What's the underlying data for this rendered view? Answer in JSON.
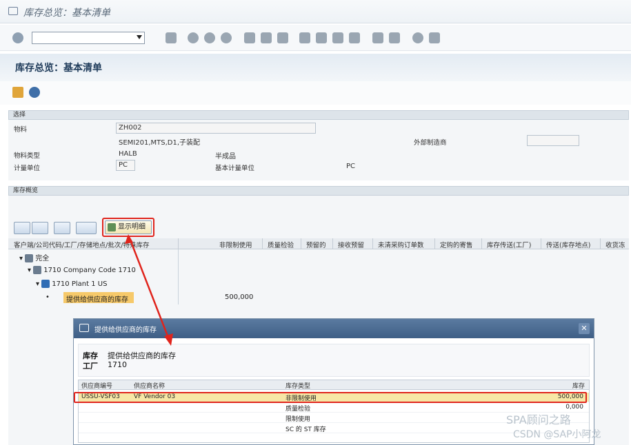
{
  "window": {
    "title": "库存总览：基本清单"
  },
  "banner": {
    "title": "库存总览：基本清单"
  },
  "selection": {
    "section_label": "选择",
    "material_label": "物料",
    "material_value": "ZH002",
    "material_desc": "SEMI201,MTS,D1,子装配",
    "ext_vendor_label": "外部制造商",
    "ext_vendor_value": "",
    "type_label": "物料类型",
    "type_code": "HALB",
    "type_name": "半成品",
    "uom_label": "计量单位",
    "uom_value": "PC",
    "base_uom_label": "基本计量单位",
    "base_uom_value": "PC"
  },
  "overview": {
    "section_label": "库存概览",
    "detail_button": "显示明细",
    "columns": [
      "客户端/公司代码/工厂/存储地点/批次/特殊库存",
      "非限制使用",
      "质量检验",
      "预留的",
      "接收预留",
      "未清采购订单数",
      "定购的寄售",
      "库存传送(工厂)",
      "传送(库存地点)",
      "收货冻"
    ],
    "tree": [
      {
        "label": "完全"
      },
      {
        "label": "1710 Company Code 1710"
      },
      {
        "label": "1710 Plant 1 US"
      },
      {
        "label": "提供给供应商的库存",
        "value": "500,000"
      }
    ]
  },
  "dialog": {
    "title": "提供给供应商的库存",
    "info_key1": "库存",
    "info_val1": "提供给供应商的库存",
    "info_key2": "工厂",
    "info_val2": "1710",
    "columns": [
      "供应商编号",
      "供应商名称",
      "库存类型",
      "库存"
    ],
    "rows": [
      {
        "vendor_no": "USSU-VSF03",
        "vendor_name": "VF Vendor 03",
        "stock_type": "非限制使用",
        "stock": "500,000"
      },
      {
        "vendor_no": "",
        "vendor_name": "",
        "stock_type": "质量检验",
        "stock": "0,000"
      },
      {
        "vendor_no": "",
        "vendor_name": "",
        "stock_type": "限制使用",
        "stock": ""
      },
      {
        "vendor_no": "",
        "vendor_name": "",
        "stock_type": "SC 的 ST 库存",
        "stock": ""
      }
    ]
  },
  "watermark": {
    "line1": "SPA顾问之路",
    "line2": "CSDN @SAP小阿龙"
  }
}
